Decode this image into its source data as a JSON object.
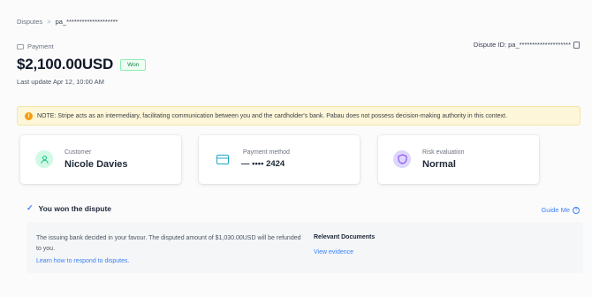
{
  "breadcrumb": {
    "root": "Disputes",
    "separator": ">",
    "current": "pa_********************"
  },
  "payment": {
    "label": "Payment",
    "amount": "$2,100.00USD",
    "status_badge": "Won",
    "last_update": "Last update Apr 12, 10:00 AM",
    "dispute_id": "Dispute ID: pa_********************"
  },
  "note": {
    "text": "NOTE: Stripe acts as an intermediary, facilitating communication between you and the cardholder's bank. Pabau does not possess decision-making authority in this context."
  },
  "cards": {
    "customer": {
      "label": "Customer",
      "value": "Nicole Davies",
      "icon": "person-icon"
    },
    "payment_method": {
      "label": "Payment method",
      "value": "•••• 2424",
      "brand_mark": "—",
      "icon": "card-icon"
    },
    "risk": {
      "label": "Risk evaluation",
      "value": "Normal",
      "icon": "shield-icon"
    }
  },
  "outcome": {
    "title": "You won the dispute",
    "guide_label": "Guide Me",
    "description": "The issuing bank decided in your favour. The disputed amount of $1,030.00USD will be refunded to you.",
    "learn_link": "Learn how to respond to disputes.",
    "documents_title": "Relevant Documents",
    "documents_link": "View evidence"
  },
  "colors": {
    "accent": "#3b82f6",
    "success": "#15803d",
    "note_bg": "#fdf6d8"
  }
}
